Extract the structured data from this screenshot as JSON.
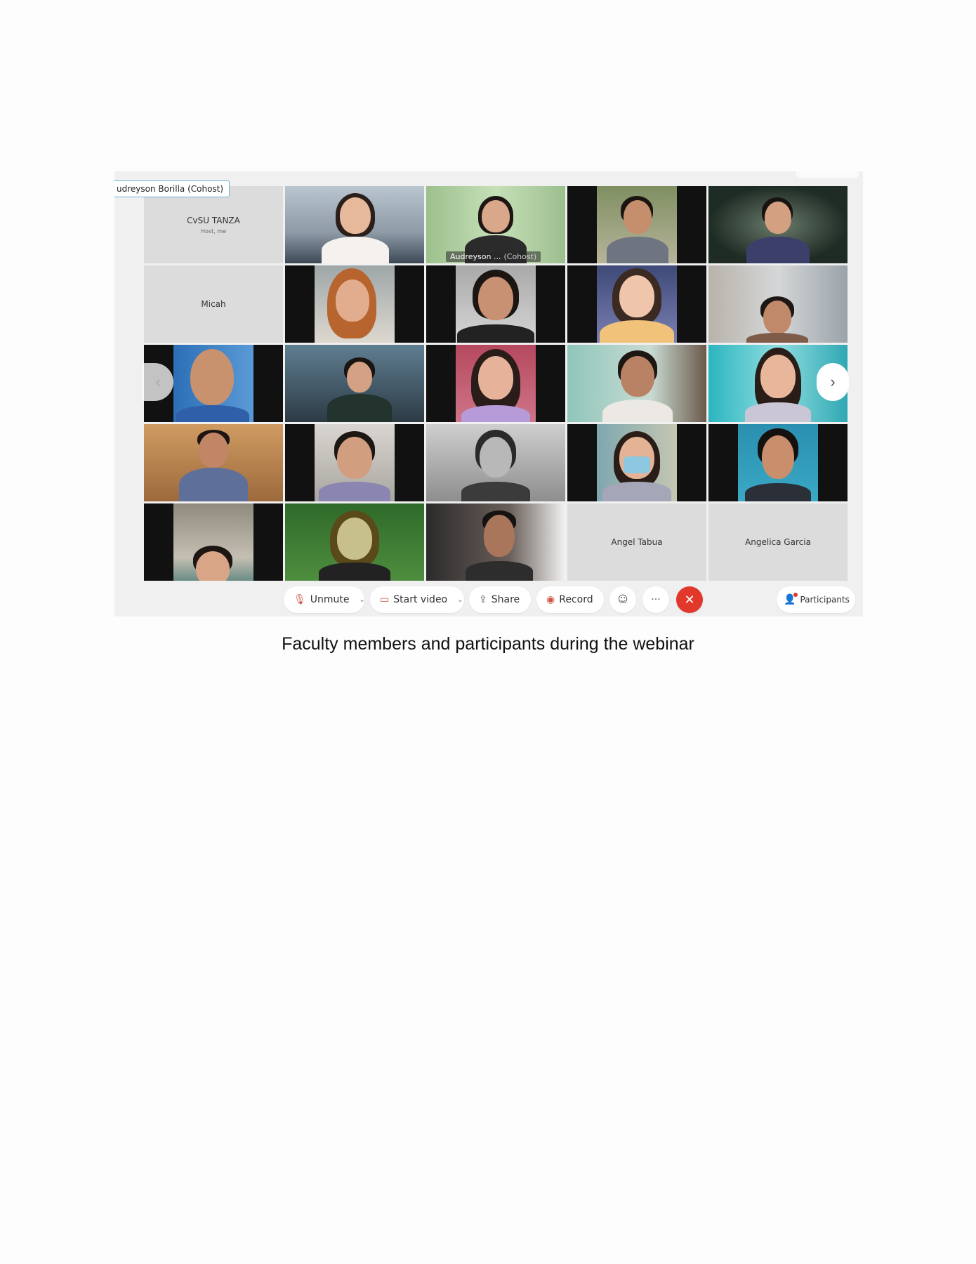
{
  "meeting": {
    "active_speaker": "udreyson Borilla (Cohost)",
    "tiles": {
      "host_name": "CvSU TANZA",
      "host_sub": "Host, me",
      "cohost_name": "Audreyson ...",
      "cohost_role": "(Cohost)",
      "micah": "Micah",
      "angel": "Angel Tabua",
      "angelica": "Angelica Garcia"
    },
    "nav": {
      "prev": "‹",
      "next": "›"
    },
    "toolbar": {
      "unmute": "Unmute",
      "start_video": "Start video",
      "share": "Share",
      "record": "Record",
      "more": "···",
      "leave": "✕",
      "participants": "Participants"
    }
  },
  "caption": "Faculty members and participants during the webinar",
  "colors": {
    "accent": "#2ab0e6",
    "leave": "#e1382b"
  }
}
